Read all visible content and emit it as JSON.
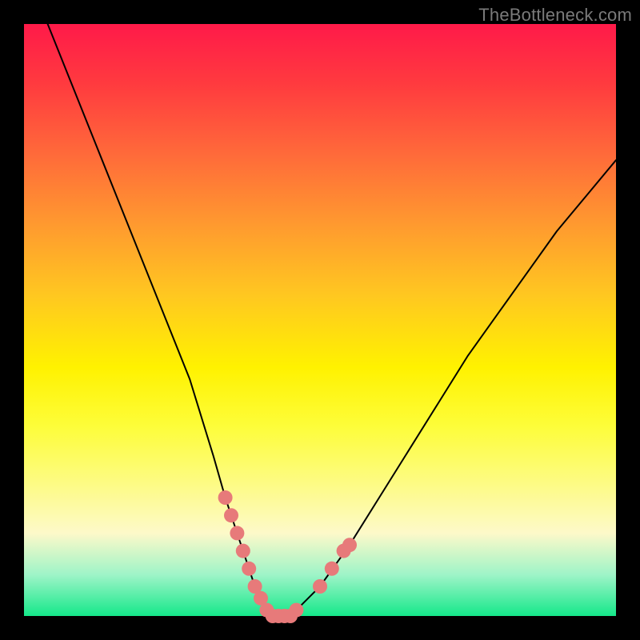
{
  "watermark": "TheBottleneck.com",
  "chart_data": {
    "type": "line",
    "title": "",
    "xlabel": "",
    "ylabel": "",
    "xlim": [
      0,
      100
    ],
    "ylim": [
      0,
      100
    ],
    "grid": false,
    "legend": null,
    "series": [
      {
        "name": "curve",
        "x": [
          4,
          8,
          12,
          16,
          20,
          24,
          28,
          32,
          34,
          36,
          37,
          38,
          39,
          40,
          41,
          42,
          43,
          44,
          45,
          46,
          50,
          55,
          60,
          65,
          70,
          75,
          80,
          85,
          90,
          95,
          100
        ],
        "y": [
          100,
          90,
          80,
          70,
          60,
          50,
          40,
          27,
          20,
          14,
          11,
          8,
          5,
          3,
          1,
          0,
          0,
          0,
          0,
          1,
          5,
          12,
          20,
          28,
          36,
          44,
          51,
          58,
          65,
          71,
          77
        ]
      }
    ],
    "markers": [
      {
        "name": "left-segment-dot",
        "x": 34.0,
        "y": 20.0
      },
      {
        "name": "left-segment-dot",
        "x": 35.0,
        "y": 17.0
      },
      {
        "name": "left-segment-dot",
        "x": 36.0,
        "y": 14.0
      },
      {
        "name": "left-segment-dot",
        "x": 37.0,
        "y": 11.0
      },
      {
        "name": "left-segment-dot",
        "x": 38.0,
        "y": 8.0
      },
      {
        "name": "left-segment-dot",
        "x": 39.0,
        "y": 5.0
      },
      {
        "name": "left-segment-dot",
        "x": 40.0,
        "y": 3.0
      },
      {
        "name": "bottom-segment-dot",
        "x": 41.0,
        "y": 1.0
      },
      {
        "name": "bottom-segment-dot",
        "x": 42.0,
        "y": 0.0
      },
      {
        "name": "bottom-segment-dot",
        "x": 43.0,
        "y": 0.0
      },
      {
        "name": "bottom-segment-dot",
        "x": 44.0,
        "y": 0.0
      },
      {
        "name": "bottom-segment-dot",
        "x": 45.0,
        "y": 0.0
      },
      {
        "name": "bottom-segment-dot",
        "x": 46.0,
        "y": 1.0
      },
      {
        "name": "right-segment-dot",
        "x": 50.0,
        "y": 5.0
      },
      {
        "name": "right-segment-dot",
        "x": 52.0,
        "y": 8.0
      },
      {
        "name": "right-segment-dot",
        "x": 54.0,
        "y": 11.0
      },
      {
        "name": "right-segment-dot",
        "x": 55.0,
        "y": 12.0
      }
    ],
    "colors": {
      "curve_stroke": "#000000",
      "marker_fill": "#e77a7a",
      "background_top": "#ff1a49",
      "background_bottom": "#15e88a"
    }
  }
}
